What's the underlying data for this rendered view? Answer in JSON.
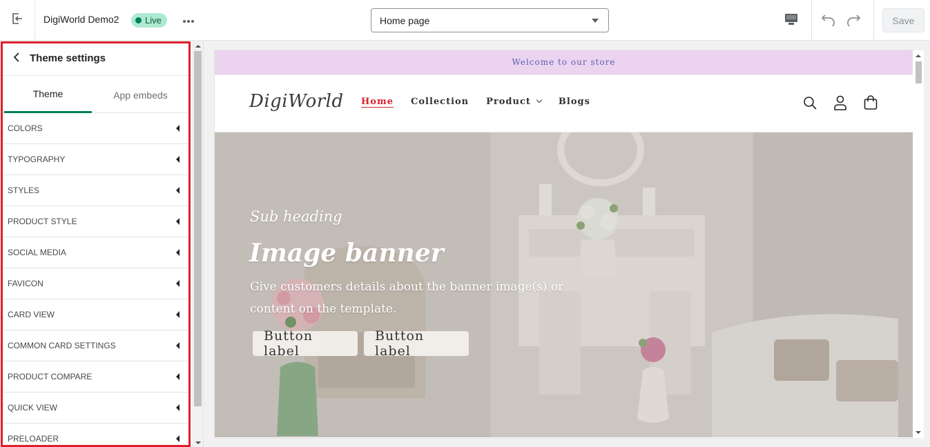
{
  "topbar": {
    "exit_icon": "exit-icon",
    "store_name": "DigiWorld Demo2",
    "status_badge": "Live",
    "more_icon": "more-horizontal-icon",
    "page_selector": "Home page",
    "device_icon": "desktop-icon",
    "undo_icon": "undo-icon",
    "redo_icon": "redo-icon",
    "save_label": "Save"
  },
  "panel": {
    "back_icon": "chevron-left-icon",
    "title": "Theme settings",
    "tabs": [
      {
        "label": "Theme",
        "active": true
      },
      {
        "label": "App embeds",
        "active": false
      }
    ],
    "items": [
      {
        "label": "COLORS"
      },
      {
        "label": "TYPOGRAPHY"
      },
      {
        "label": "STYLES"
      },
      {
        "label": "PRODUCT STYLE"
      },
      {
        "label": "SOCIAL MEDIA"
      },
      {
        "label": "FAVICON"
      },
      {
        "label": "CARD VIEW"
      },
      {
        "label": "COMMON CARD SETTINGS"
      },
      {
        "label": "PRODUCT COMPARE"
      },
      {
        "label": "QUICK VIEW"
      },
      {
        "label": "PRELOADER"
      }
    ]
  },
  "preview": {
    "announcement": "Welcome to our store",
    "logo": "DigiWorld",
    "nav": [
      {
        "label": "Home",
        "active": true
      },
      {
        "label": "Collection",
        "active": false
      },
      {
        "label": "Product",
        "active": false
      },
      {
        "label": "Blogs",
        "active": false
      }
    ],
    "header_icons": [
      "search-icon",
      "account-icon",
      "cart-icon"
    ],
    "banner": {
      "sub_heading": "Sub heading",
      "title": "Image banner",
      "text": "Give customers details about the banner image(s) or content on the template.",
      "button_1": "Button label",
      "button_2": "Button label"
    }
  },
  "colors": {
    "accent_red": "#e01e2b",
    "tab_underline": "#008060",
    "live_badge": "#aee9d1",
    "announcement_bg": "#ecd4f0",
    "nav_active": "#d8232a"
  }
}
